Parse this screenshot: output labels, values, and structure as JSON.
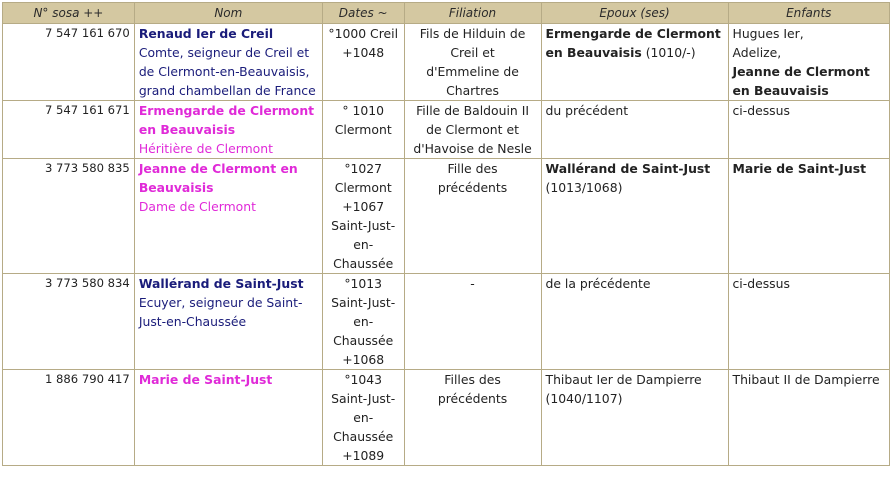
{
  "headers": {
    "sosa": "N° sosa ++",
    "nom": "Nom",
    "dates": "Dates ~",
    "filiation": "Filiation",
    "epoux": "Epoux (ses)",
    "enfants": "Enfants"
  },
  "rows": [
    {
      "sosa": "7 547 161 670",
      "name": "Renaud Ier de Creil",
      "title": "Comte, seigneur de Creil et de Clermont-en-Beauvaisis, grand chambellan de France",
      "dates": [
        "°1000 Creil",
        "+1048"
      ],
      "filiation": [
        "Fils de Hilduin de",
        "Creil et",
        "d'Emmeline de",
        "Chartres"
      ],
      "spouse_bold": "Ermengarde de Clermont en Beauvaisis",
      "spouse_rest": " (1010/-)",
      "children": [
        "Hugues Ier,",
        "Adelize,"
      ],
      "children_bold": "Jeanne de Clermont en Beauvaisis"
    },
    {
      "sosa": "7 547 161 671",
      "name": "Ermengarde de Clermont en Beauvaisis",
      "title": "Héritière de Clermont",
      "dates": [
        "° 1010",
        "Clermont"
      ],
      "filiation": [
        "Fille de Baldouin II",
        "de Clermont et",
        "d'Havoise de Nesle"
      ],
      "spouse": "du précédent",
      "children_text": "ci-dessus"
    },
    {
      "sosa": "3 773 580 835",
      "name": "Jeanne de Clermont en Beauvaisis",
      "title": "Dame de Clermont",
      "dates": [
        "°1027",
        "Clermont",
        "+1067",
        "Saint-Just-",
        "en-",
        "Chaussée"
      ],
      "filiation": [
        "Fille des",
        "précédents"
      ],
      "spouse_bold": "Wallérand de Saint-Just",
      "spouse_rest": "(1013/1068)",
      "children_bold": "Marie de Saint-Just"
    },
    {
      "sosa": "3 773 580 834",
      "name": "Wallérand de Saint-Just",
      "title": "Ecuyer, seigneur de Saint-Just-en-Chaussée",
      "dates": [
        "°1013",
        "Saint-Just-",
        "en-",
        "Chaussée",
        "+1068"
      ],
      "filiation": [
        "-"
      ],
      "spouse": "de la précédente",
      "children_text": "ci-dessus"
    },
    {
      "sosa": "1 886 790 417",
      "name": "Marie de Saint-Just",
      "title": "",
      "dates": [
        "°1043",
        "Saint-Just-",
        "en-",
        "Chaussée",
        "+1089"
      ],
      "filiation": [
        "Filles des",
        "précédents"
      ],
      "spouse": "Thibaut Ier de Dampierre (1040/1107)",
      "children_text": "Thibaut II de Dampierre"
    }
  ]
}
